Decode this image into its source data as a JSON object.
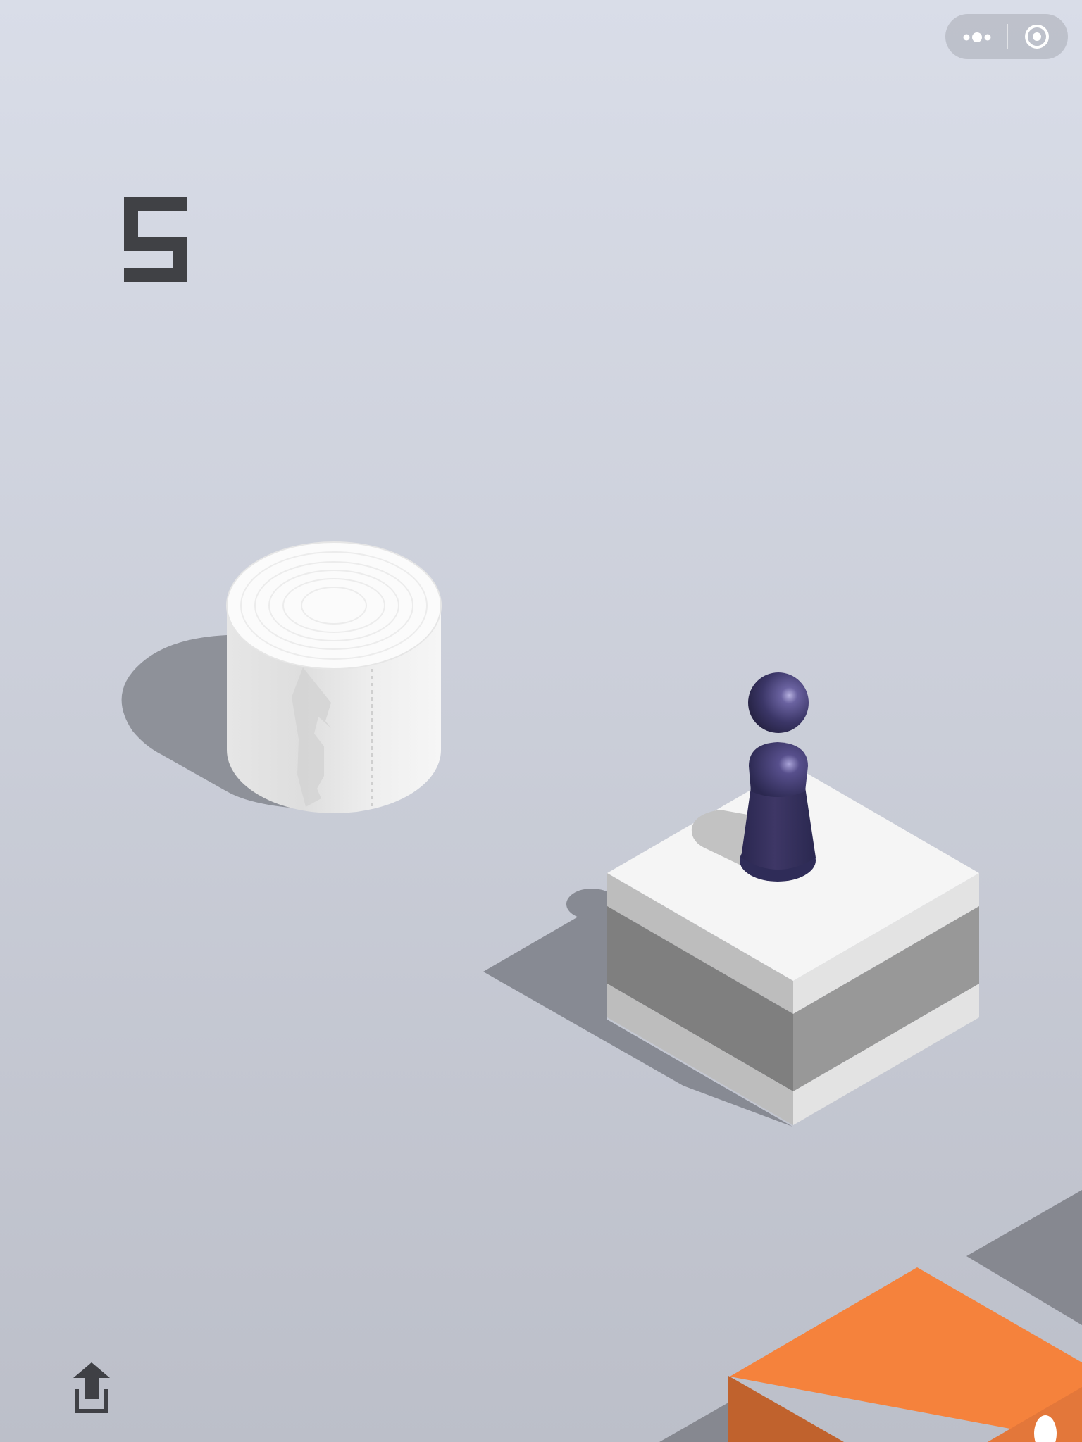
{
  "game": {
    "score": "5",
    "score_digits": [
      "5"
    ]
  },
  "top_capsule": {
    "more_icon": "more-dots-icon",
    "close_icon": "target-circle-icon"
  },
  "bottom_bar": {
    "share_icon": "share-upload-icon"
  },
  "colors": {
    "background_top": "#d9dde8",
    "background_bottom": "#bcbfc9",
    "score": "#3f4045",
    "player": "#2f2b55",
    "cylinder_platform": "#f4f4f4",
    "cube_platform_top": "#f5f5f5",
    "cube_platform_band": "#808080",
    "next_platform": "#f5823c"
  }
}
